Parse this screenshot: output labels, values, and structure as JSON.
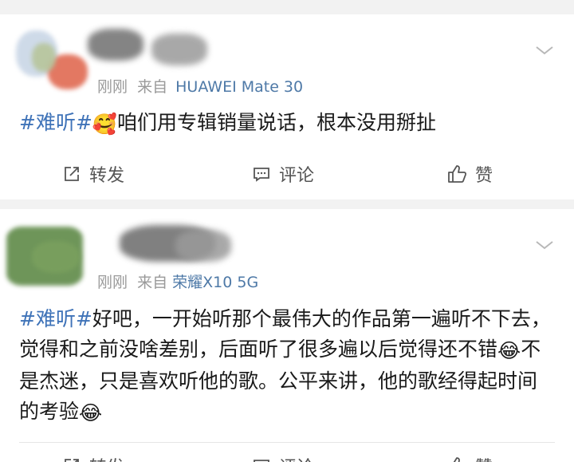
{
  "posts": [
    {
      "meta_time": "刚刚",
      "meta_from": "来自",
      "device": "HUAWEI Mate 30",
      "hashtag": "#难听#",
      "emoji_1": "🥰",
      "text": "咱们用专辑销量说话，根本没用掰扯",
      "actions": {
        "repost": "转发",
        "comment": "评论",
        "like": "赞"
      }
    },
    {
      "meta_time": "刚刚",
      "meta_from": "来自",
      "device": "荣耀X10 5G",
      "hashtag": "#难听#",
      "text_part1": "好吧，一开始听那个最伟大的作品第一遍听不下去，觉得和之前没啥差别，后面听了很多遍以后觉得还不错",
      "emoji_1": "😂",
      "text_part2": "不是杰迷，只是喜欢听他的歌。公平来讲，他的歌经得起时间的考验",
      "emoji_2": "😂",
      "actions": {
        "repost": "转发",
        "comment": "评论",
        "like": "赞"
      }
    }
  ],
  "icons": {
    "chevron": "chevron-down-icon",
    "repost": "repost-icon",
    "comment": "comment-icon",
    "like": "thumbs-up-icon"
  },
  "colors": {
    "hashtag": "#3f73b8",
    "device": "#4e79a7",
    "meta": "#9a9a9a",
    "background": "#f2f2f2"
  }
}
